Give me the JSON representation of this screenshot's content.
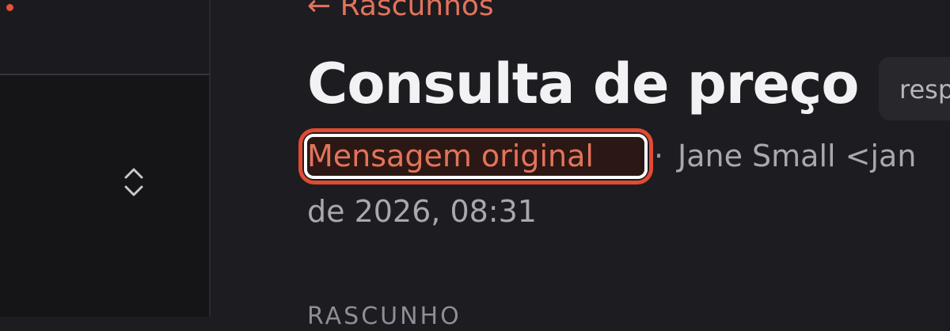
{
  "sidebar": {
    "stepper_icon": "chevron-up-down-icon",
    "status_dot_color": "#e8513a"
  },
  "header": {
    "back_label": "← Rascunhos",
    "title": "Consulta de preço",
    "tag": "resp"
  },
  "meta": {
    "original_link": "Mensagem original",
    "separator": "·",
    "sender": "Jane Small <jan",
    "date": "de 2026, 08:31"
  },
  "section": {
    "label": "RASCUNHO"
  },
  "colors": {
    "accent": "#e3735c",
    "highlight": "#e24a33",
    "background": "#1d1c20",
    "title": "#f2f1f3"
  }
}
